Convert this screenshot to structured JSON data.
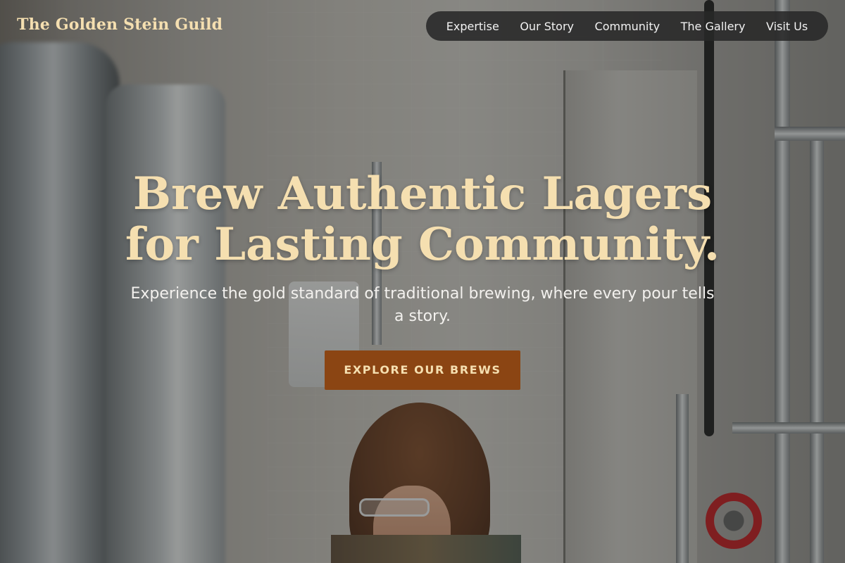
{
  "header": {
    "brand": "The Golden Stein Guild",
    "nav": [
      {
        "label": "Expertise"
      },
      {
        "label": "Our Story"
      },
      {
        "label": "Community"
      },
      {
        "label": "The Gallery"
      },
      {
        "label": "Visit Us"
      }
    ]
  },
  "hero": {
    "title": "Brew Authentic Lagers for Lasting Community.",
    "subtitle": "Experience the gold standard of traditional brewing, where every pour tells a story.",
    "cta_label": "Explore Our Brews",
    "background": "brewery-interior-photo"
  },
  "colors": {
    "accent_gold": "#f5dfb0",
    "cta_brown": "#8b4513",
    "nav_pill": "#282828"
  }
}
